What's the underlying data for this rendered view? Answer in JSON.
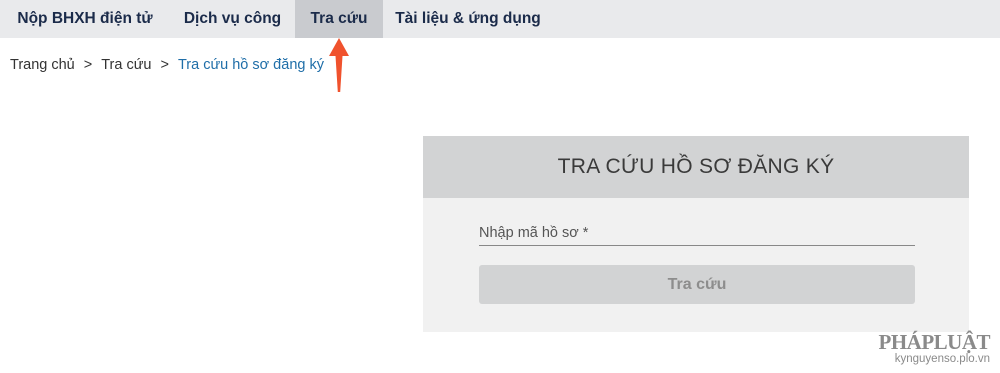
{
  "nav": {
    "items": [
      {
        "label": "Nộp BHXH điện tử"
      },
      {
        "label": "Dịch vụ công"
      },
      {
        "label": "Tra cứu",
        "active": true
      },
      {
        "label": "Tài liệu & ứng dụng"
      }
    ]
  },
  "breadcrumb": {
    "home": "Trang chủ",
    "separator": ">",
    "section": "Tra cứu",
    "current": "Tra cứu hồ sơ đăng ký"
  },
  "lookup_form": {
    "title": "TRA CỨU HỒ SƠ ĐĂNG KÝ",
    "field_label": "Nhập mã hồ sơ *",
    "field_value": "",
    "submit_label": "Tra cứu"
  },
  "annotation": {
    "icon": "arrow-up-icon",
    "color": "#f0522d"
  },
  "watermark": {
    "logo": "PHÁPLUẬT",
    "url": "kynguyenso.plo.vn"
  },
  "colors": {
    "nav_bg": "#e9eaec",
    "nav_active_bg": "#c9cbcf",
    "nav_text": "#1b2b4a",
    "breadcrumb_link": "#1f6ea8",
    "card_bg": "#f1f1f1",
    "card_header_bg": "#d2d3d4"
  }
}
